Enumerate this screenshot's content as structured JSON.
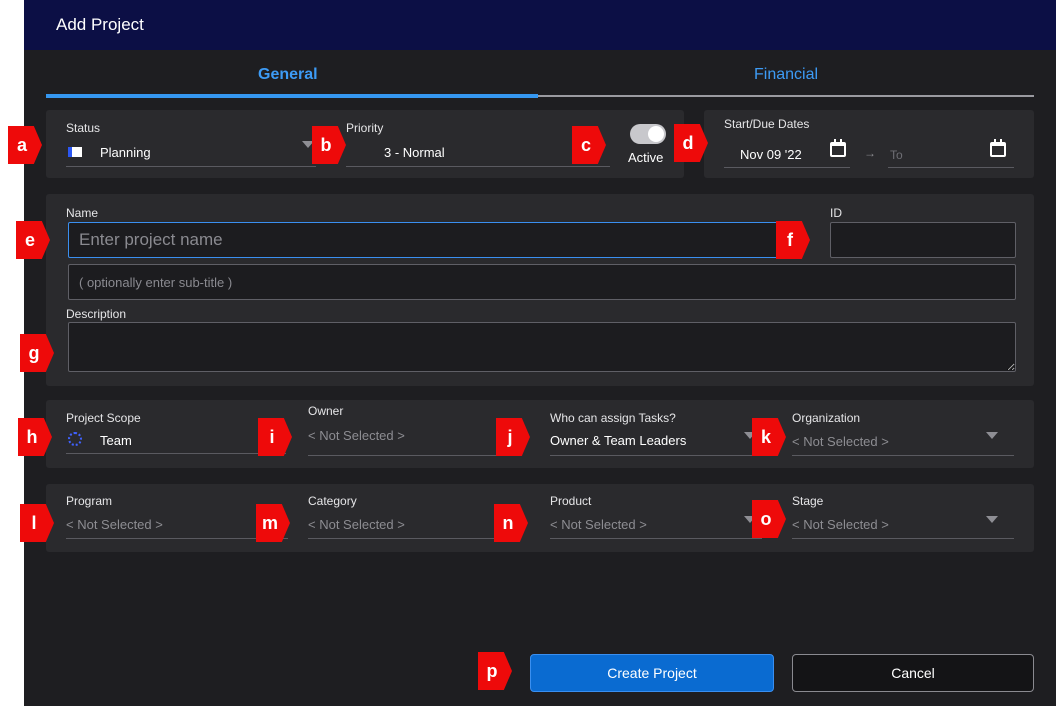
{
  "dialog": {
    "title": "Add Project"
  },
  "tabs": [
    {
      "label": "General",
      "active": true
    },
    {
      "label": "Financial",
      "active": false
    }
  ],
  "status": {
    "label": "Status",
    "value": "Planning"
  },
  "priority": {
    "label": "Priority",
    "value": "3 - Normal"
  },
  "active_toggle": {
    "label": "Active",
    "on": true
  },
  "dates": {
    "label": "Start/Due Dates",
    "start": "Nov 09 '22",
    "arrow": "→",
    "end_placeholder": "To"
  },
  "name": {
    "label": "Name",
    "placeholder": "Enter project name",
    "subtitle_placeholder": "( optionally enter sub-title )"
  },
  "id_field": {
    "label": "ID",
    "value": ""
  },
  "description": {
    "label": "Description",
    "value": ""
  },
  "scope": {
    "label": "Project Scope",
    "value": "Team"
  },
  "owner": {
    "label": "Owner",
    "value": "< Not Selected >"
  },
  "assign": {
    "label": "Who can assign Tasks?",
    "value": "Owner & Team Leaders"
  },
  "organization": {
    "label": "Organization",
    "value": "< Not Selected >"
  },
  "program": {
    "label": "Program",
    "value": "< Not Selected >"
  },
  "category": {
    "label": "Category",
    "value": "< Not Selected >"
  },
  "product": {
    "label": "Product",
    "value": "< Not Selected >"
  },
  "stage": {
    "label": "Stage",
    "value": "< Not Selected >"
  },
  "buttons": {
    "create": "Create Project",
    "cancel": "Cancel"
  },
  "markers": [
    "a",
    "b",
    "c",
    "d",
    "e",
    "f",
    "g",
    "h",
    "i",
    "j",
    "k",
    "l",
    "m",
    "n",
    "o",
    "p"
  ],
  "colors": {
    "titlebar": "#0c0f45",
    "accent": "#3597f0",
    "primary_button": "#0a6bd1",
    "marker": "#ee0a0a"
  }
}
